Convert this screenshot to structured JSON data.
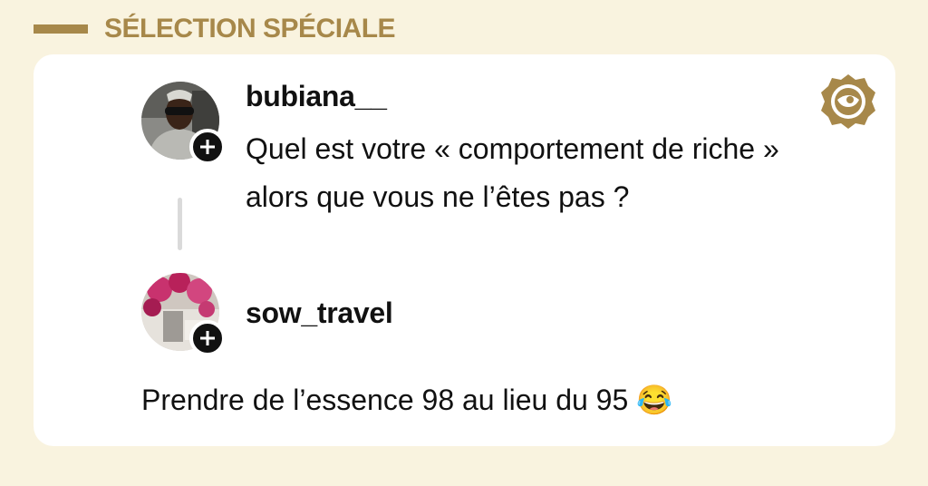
{
  "header": {
    "title": "SÉLECTION SPÉCIALE"
  },
  "colors": {
    "page_background": "#f9f3df",
    "accent_gold": "#a7884a",
    "card_background": "#ffffff",
    "text": "#111111"
  },
  "post": {
    "username": "bubiana__",
    "text": "Quel est votre « comportement de riche » alors que vous ne l’êtes pas ?",
    "avatar_icon": "user-avatar-photo",
    "follow_icon": "plus-icon"
  },
  "reply": {
    "username": "sow_travel",
    "text": "Prendre de l’essence 98 au lieu du 95",
    "emoji": "😂",
    "avatar_icon": "user-avatar-photo",
    "follow_icon": "plus-icon"
  },
  "brand": {
    "icon": "brand-logo-icon"
  }
}
